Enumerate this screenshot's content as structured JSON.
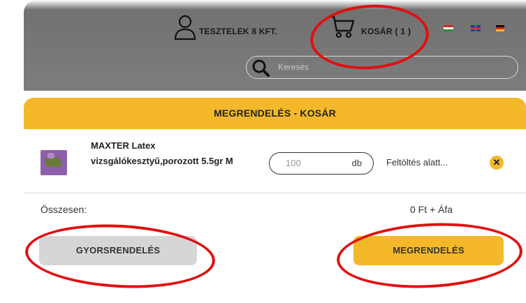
{
  "header": {
    "account_label": "TESZTELEK 8 KFT.",
    "cart_label": "KOSÁR ( 1 )",
    "languages": [
      "hu-flag",
      "en-flag",
      "de-flag"
    ]
  },
  "search": {
    "placeholder": "Keresés"
  },
  "cart_panel": {
    "title": "MEGRENDELÉS - KOSÁR",
    "items": [
      {
        "name": "MAXTER Latex vizsgálókesztyű,porozott 5.5gr M",
        "quantity": "100",
        "unit": "db",
        "status": "Feltöltés alatt..."
      }
    ],
    "total_label": "Összesen:",
    "total_value": "0 Ft + Áfa",
    "quick_order_label": "GYORSRENDELÉS",
    "order_label": "MEGRENDELÉS"
  },
  "colors": {
    "accent": "#f5b82b",
    "header_bg": "#767676",
    "annotation": "#e01010"
  },
  "icons": {
    "user": "user-icon",
    "cart": "cart-icon",
    "search": "search-icon",
    "remove": "close-icon"
  }
}
